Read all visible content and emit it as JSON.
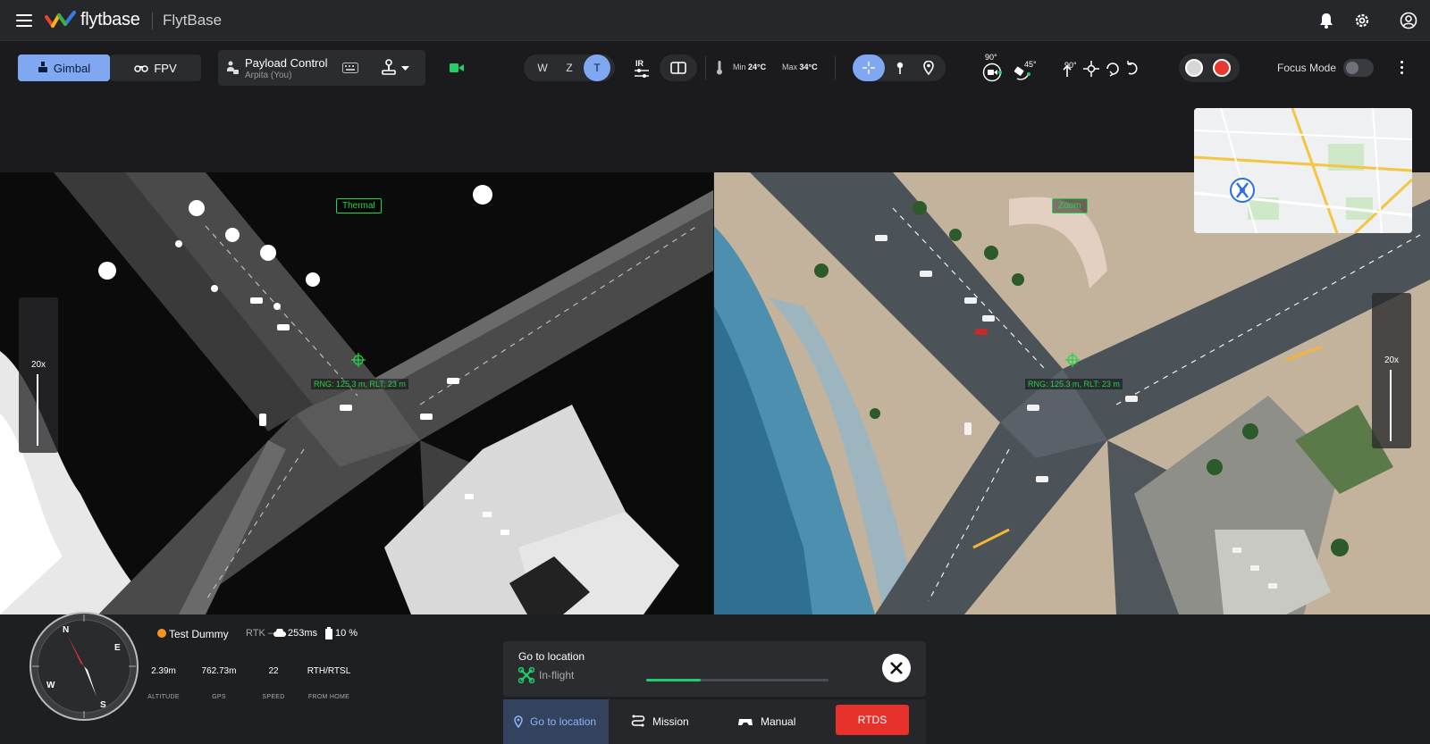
{
  "header": {
    "logo_text": "flytbase",
    "brand_name": "FlytBase"
  },
  "toolbar": {
    "gimbal_label": "Gimbal",
    "fpv_label": "FPV",
    "payload_title": "Payload Control",
    "payload_user": "Arpita (You)",
    "lens_w": "W",
    "lens_z": "Z",
    "lens_t": "T",
    "ir_label": "IR",
    "temp_min_label": "Min",
    "temp_min_value": "24°C",
    "temp_max_label": "Max",
    "temp_max_value": "34°C",
    "gimbal_pitch_90": "90°",
    "gimbal_pitch_45": "45°",
    "rotate_90": "90°",
    "focus_mode_label": "Focus Mode",
    "focus_mode_on": false
  },
  "feeds": {
    "thermal_tag": "Thermal",
    "zoom_tag": "Zoom",
    "thermal_range": "RNG: 125.3 m, RLT: 23 m",
    "zoom_range": "RNG: 125.3 m, RLT: 23 m",
    "thermal_zoom": "20x",
    "zoom_zoom": "20x"
  },
  "drone": {
    "name": "Test Dummy",
    "rtk": "RTK –",
    "latency": "253ms",
    "battery": "10 %",
    "status_color": "#f7931e"
  },
  "telemetry": [
    {
      "value": "2.39m",
      "label": "ALTITUDE"
    },
    {
      "value": "762.73m",
      "label": "GPS"
    },
    {
      "value": "22",
      "label": "SPEED"
    },
    {
      "value": "RTH/RTSL",
      "label": "FROM HOME"
    }
  ],
  "mission": {
    "title": "Go to location",
    "state": "In-flight",
    "progress": 0.3
  },
  "tabs": {
    "go_to_location": "Go to location",
    "mission": "Mission",
    "manual": "Manual",
    "rtds": "RTDS"
  },
  "colors": {
    "accent": "#7fa7f2",
    "record": "#e8382f",
    "rtds": "#e6322a",
    "overlay_green": "#22d44a"
  }
}
